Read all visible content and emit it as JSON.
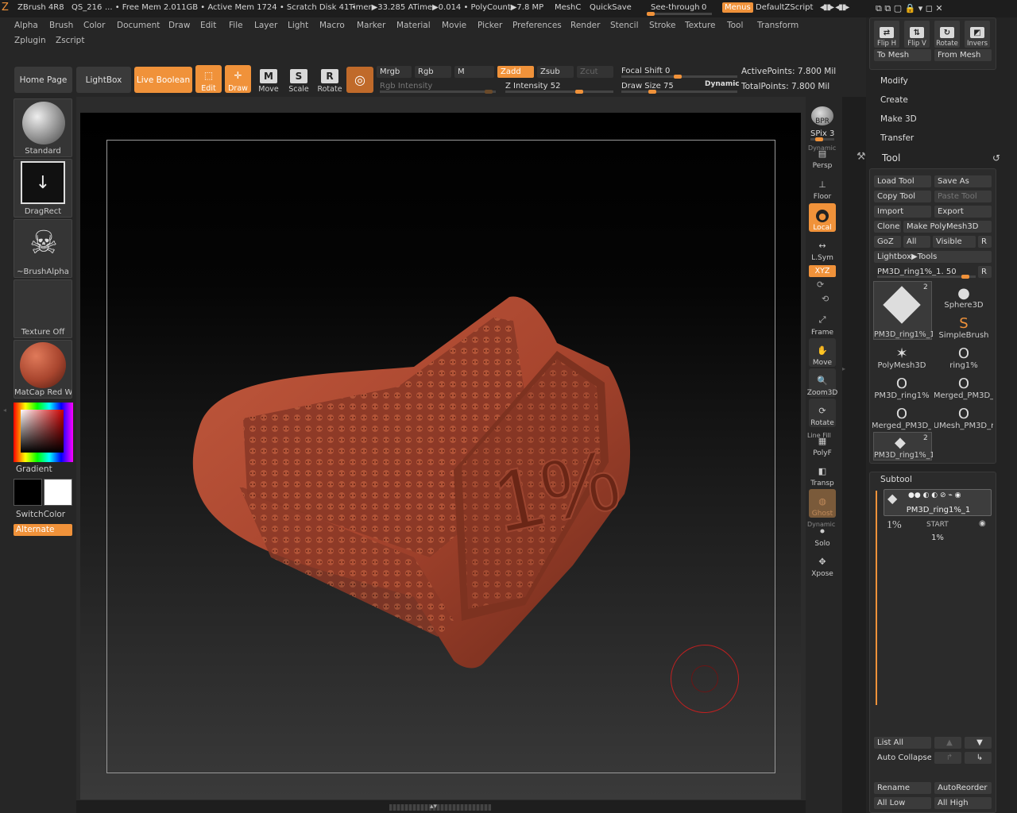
{
  "titlebar": {
    "app": "ZBrush 4R8",
    "quicksave_slot": "QS_216",
    "status": "... • Free Mem 2.011GB • Active Mem 1724 • Scratch Disk 41 •",
    "timer": "Timer▶33.285 ATime▶0.014 • PolyCount▶7.8 MP",
    "meshc": "MeshC",
    "quicksave": "QuickSave",
    "see_through": "See-through",
    "see_through_value": "0",
    "menus": "Menus",
    "script": "DefaultZScript"
  },
  "menubar": [
    "Alpha",
    "Brush",
    "Color",
    "Document",
    "Draw",
    "Edit",
    "File",
    "Layer",
    "Light",
    "Macro",
    "Marker",
    "Material",
    "Movie",
    "Picker",
    "Preferences",
    "Render",
    "Stencil",
    "Stroke",
    "Texture",
    "Tool",
    "Transform"
  ],
  "menubar2": [
    "Zplugin",
    "Zscript"
  ],
  "shelf": {
    "home_page": "Home Page",
    "lightbox": "LightBox",
    "live_boolean": "Live Boolean",
    "edit": "Edit",
    "draw": "Draw",
    "move": "Move",
    "scale": "Scale",
    "rotate": "Rotate",
    "mrgb": "Mrgb",
    "rgb": "Rgb",
    "m": "M",
    "zadd": "Zadd",
    "zsub": "Zsub",
    "zcut": "Zcut",
    "rgb_intensity": "Rgb Intensity",
    "z_intensity": "Z Intensity 52",
    "focal_shift": "Focal Shift 0",
    "draw_size": "Draw Size 75",
    "dynamic": "Dynamic",
    "active_points": "ActivePoints: 7.800 Mil",
    "total_points": "TotalPoints: 7.800 Mil"
  },
  "left": {
    "brush": "Standard",
    "stroke": "DragRect",
    "alpha": "~BrushAlpha",
    "texture": "Texture Off",
    "material": "MatCap Red Wax",
    "gradient": "Gradient",
    "switch_color": "SwitchColor",
    "alternate": "Alternate"
  },
  "canvas": {
    "model_text": "1%"
  },
  "right": {
    "bpr": "BPR",
    "spix": "SPix 3",
    "dynamic": "Dynamic",
    "persp": "Persp",
    "floor": "Floor",
    "local": "Local",
    "lsym": "L.Sym",
    "xyz": "XYZ",
    "frame": "Frame",
    "move": "Move",
    "zoom3d": "Zoom3D",
    "rotate": "Rotate",
    "line_fill": "Line Fill",
    "polyf": "PolyF",
    "transp": "Transp",
    "ghost": "Ghost",
    "dynamic2": "Dynamic",
    "solo": "Solo",
    "xpose": "Xpose"
  },
  "tray": {
    "flip_h": "Flip H",
    "flip_v": "Flip V",
    "rotate": "Rotate",
    "invers": "Invers",
    "to_mesh": "To Mesh",
    "from_mesh": "From Mesh",
    "modify": "Modify",
    "create": "Create",
    "make3d": "Make 3D",
    "transfer": "Transfer",
    "tool_title": "Tool",
    "load_tool": "Load Tool",
    "save_as": "Save As",
    "copy_tool": "Copy Tool",
    "paste_tool": "Paste Tool",
    "import": "Import",
    "export": "Export",
    "clone": "Clone",
    "make_polymesh": "Make PolyMesh3D",
    "goz": "GoZ",
    "all": "All",
    "visible": "Visible",
    "r": "R",
    "lightbox_tools": "Lightbox▶Tools",
    "current_tool": "PM3D_ring1%_1. 50",
    "tools": [
      {
        "label": "PM3D_ring1%_1",
        "icon": "◆",
        "badge": "2"
      },
      {
        "label": "Sphere3D",
        "icon": "●",
        "badge": ""
      },
      {
        "label": "SimpleBrush",
        "icon": "S",
        "badge": ""
      },
      {
        "label": "PolyMesh3D",
        "icon": "✶",
        "badge": ""
      },
      {
        "label": "ring1%",
        "icon": "O",
        "badge": ""
      },
      {
        "label": "PM3D_ring1%",
        "icon": "O",
        "badge": ""
      },
      {
        "label": "Merged_PM3D_",
        "icon": "O",
        "badge": ""
      },
      {
        "label": "Merged_PM3D_",
        "icon": "O",
        "badge": ""
      },
      {
        "label": "UMesh_PM3D_r",
        "icon": "O",
        "badge": ""
      },
      {
        "label": "PM3D_ring1%_1",
        "icon": "◆",
        "badge": "2"
      }
    ],
    "subtool_title": "Subtool",
    "subtool1": "PM3D_ring1%_1",
    "subtool2_tag": "START",
    "subtool2": "1%",
    "list_all": "List All",
    "auto_collapse": "Auto Collapse",
    "rename": "Rename",
    "auto_reorder": "AutoReorder",
    "all_low": "All Low",
    "all_high": "All High"
  },
  "colors": {
    "accent": "#f0923a",
    "model": "#a8452e"
  }
}
